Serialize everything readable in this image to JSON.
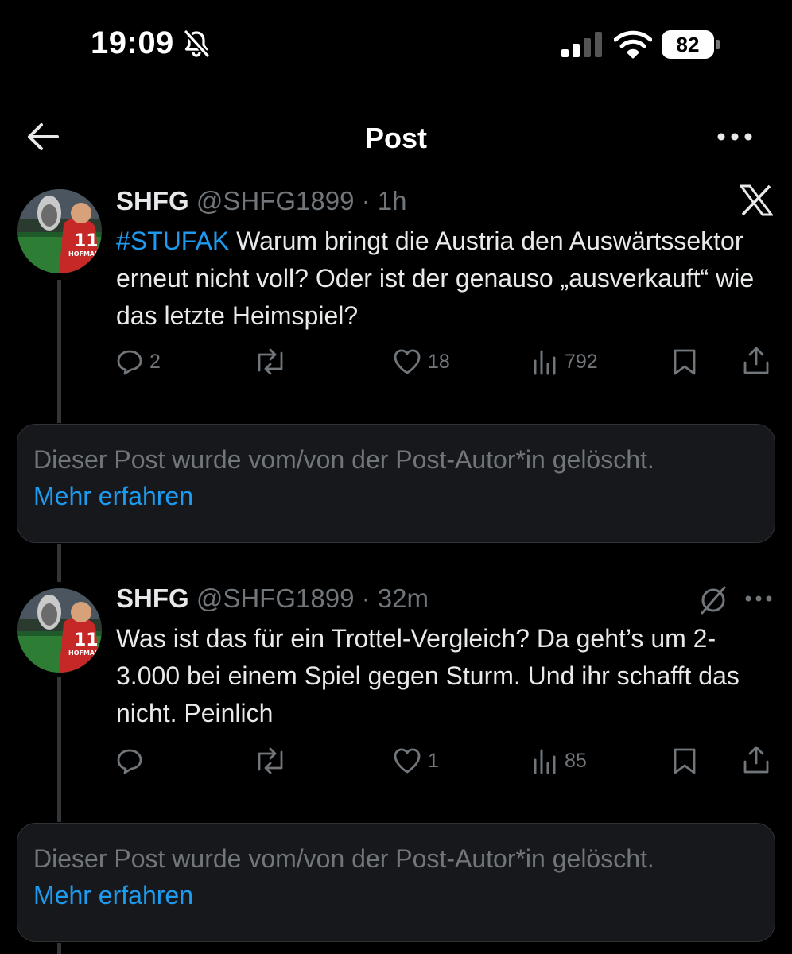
{
  "status_bar": {
    "time": "19:09",
    "battery": "82"
  },
  "header": {
    "title": "Post"
  },
  "posts": [
    {
      "name": "SHFG",
      "handle_time": "@SHFG1899 · 1h",
      "hashtag": "#STUFAK",
      "text": " Warum bringt die Austria den Auswärtssektor erneut nicht voll? Oder ist der genauso „ausverkauft“ wie das letzte Heimspiel?",
      "replies": "2",
      "reposts": "",
      "likes": "18",
      "views": "792"
    },
    {
      "name": "SHFG",
      "handle_time": "@SHFG1899 · 32m",
      "text": "Was ist das für ein Trottel-Vergleich? Da geht’s um 2-3.000 bei einem Spiel gegen Sturm. Und ihr schafft das nicht. Peinlich",
      "replies": "",
      "reposts": "",
      "likes": "1",
      "views": "85"
    }
  ],
  "deleted": [
    {
      "text": "Dieser Post wurde vom/von der Post-Autor*in gelöscht.",
      "link": "Mehr erfahren"
    },
    {
      "text": "Dieser Post wurde vom/von der Post-Autor*in gelöscht.",
      "link": "Mehr erfahren"
    }
  ],
  "colors": {
    "background": "#000000",
    "accent": "#1d9bf0",
    "muted": "#71767b",
    "text": "#e7e9ea"
  },
  "icons": [
    "bell-off-icon",
    "signal-icon",
    "wifi-icon",
    "battery-icon",
    "back-arrow-icon",
    "more-icon",
    "x-logo-icon",
    "reply-icon",
    "repost-icon",
    "like-icon",
    "views-icon",
    "bookmark-icon",
    "share-icon",
    "mute-icon"
  ]
}
